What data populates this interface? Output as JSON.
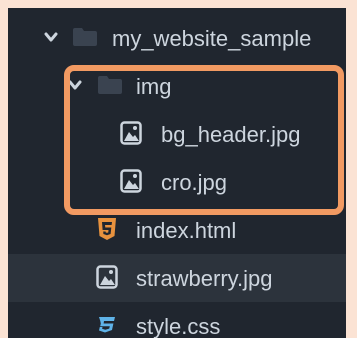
{
  "tree": {
    "root": {
      "label": "my_website_sample",
      "icon": "folder-icon",
      "expanded": true
    },
    "items": [
      {
        "label": "img",
        "type": "folder",
        "icon": "folder-icon",
        "expanded": true
      },
      {
        "label": "bg_header.jpg",
        "type": "image",
        "icon": "image-file-icon"
      },
      {
        "label": "cro.jpg",
        "type": "image",
        "icon": "image-file-icon"
      },
      {
        "label": "index.html",
        "type": "html",
        "icon": "html5-icon"
      },
      {
        "label": "strawberry.jpg",
        "type": "image",
        "icon": "image-file-icon",
        "selected": true
      },
      {
        "label": "style.css",
        "type": "css",
        "icon": "css3-icon"
      }
    ]
  },
  "colors": {
    "panel_background": "#20262f",
    "selected_row": "#2c333c",
    "text": "#cdd5de",
    "highlight_border": "#f29a62",
    "page_background": "#fbe3d4",
    "html_icon": "#e8923e",
    "css_icon": "#5fb3e8"
  }
}
